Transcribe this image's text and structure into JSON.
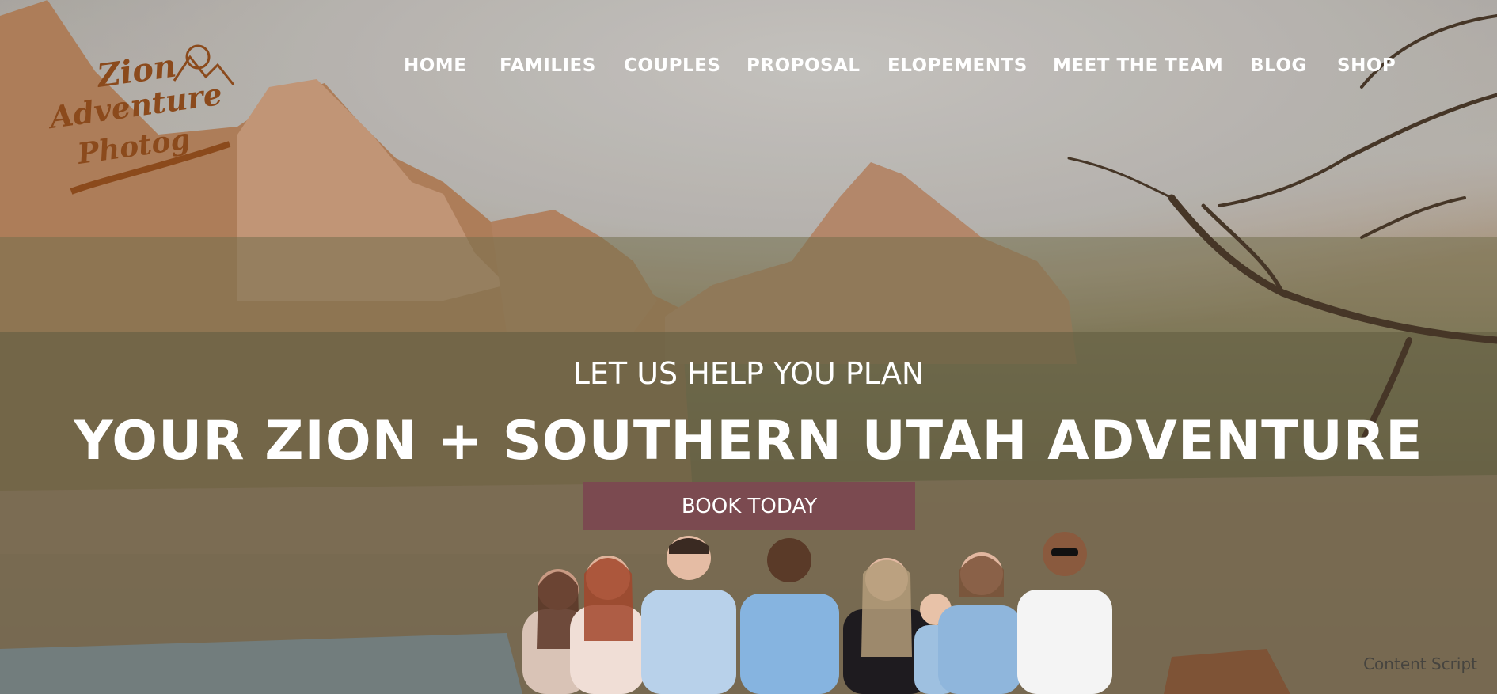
{
  "logo": {
    "line1": "Zion",
    "line2": "Adventure",
    "line3": "Photog",
    "color": "#8b4a1c"
  },
  "nav": {
    "items": [
      "HOME",
      "FAMILIES",
      "COUPLES",
      "PROPOSAL",
      "ELOPEMENTS",
      "MEET THE TEAM",
      "BLOG",
      "SHOP"
    ]
  },
  "hero": {
    "subheading": "LET US HELP YOU PLAN",
    "headline": "YOUR ZION + SOUTHERN UTAH ADVENTURE",
    "cta_label": "BOOK TODAY",
    "cta_color": "#7b4a50"
  },
  "credit": "Content Script"
}
